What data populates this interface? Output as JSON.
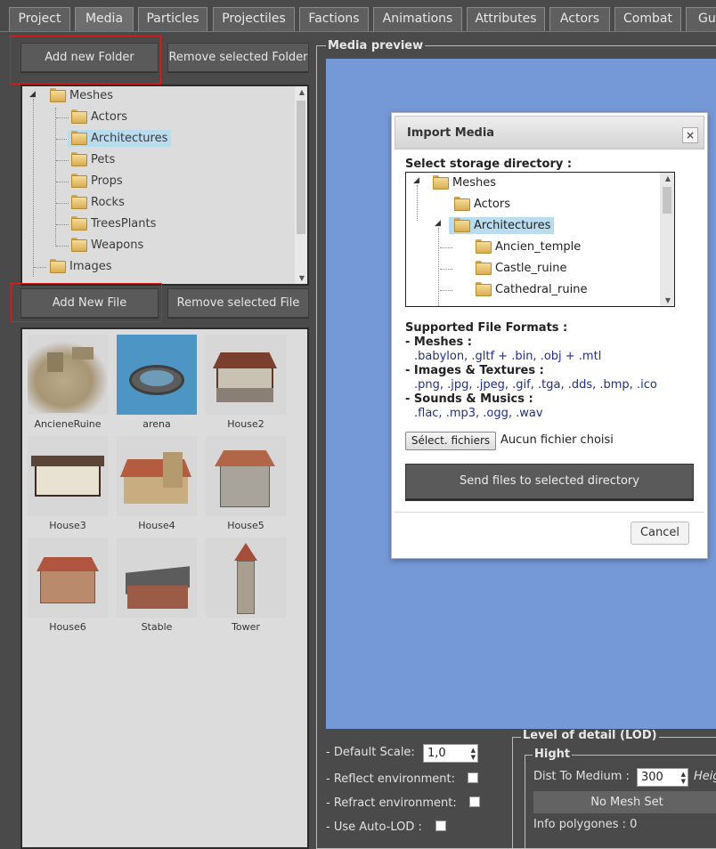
{
  "tabs": [
    "Project",
    "Media",
    "Particles",
    "Projectiles",
    "Factions",
    "Animations",
    "Attributes",
    "Actors",
    "Combat",
    "Gui"
  ],
  "active_tab": "Media",
  "folder_buttons": {
    "add": "Add new Folder",
    "remove": "Remove selected Folder"
  },
  "file_buttons": {
    "add": "Add New File",
    "remove": "Remove selected File"
  },
  "folder_tree": {
    "root": "Meshes",
    "children": [
      "Actors",
      "Architectures",
      "Pets",
      "Props",
      "Rocks",
      "TreesPlants",
      "Weapons"
    ],
    "selected": "Architectures",
    "next_root": "Images"
  },
  "files": [
    {
      "name": "AncieneRuine",
      "icon": "ruin-thumbnail"
    },
    {
      "name": "arena",
      "icon": "arena-thumbnail"
    },
    {
      "name": "House2",
      "icon": "house-thumbnail"
    },
    {
      "name": "House3",
      "icon": "house-thumbnail"
    },
    {
      "name": "House4",
      "icon": "house-thumbnail"
    },
    {
      "name": "House5",
      "icon": "house-thumbnail"
    },
    {
      "name": "House6",
      "icon": "house-thumbnail"
    },
    {
      "name": "Stable",
      "icon": "stable-thumbnail"
    },
    {
      "name": "Tower",
      "icon": "tower-thumbnail"
    }
  ],
  "preview": {
    "title": "Media preview"
  },
  "modal": {
    "title": "Import Media",
    "close": "×",
    "storage_label": "Select storage directory :",
    "tree": {
      "root": "Meshes",
      "children": [
        "Actors",
        "Architectures"
      ],
      "selected": "Architectures",
      "sub_children": [
        "Ancien_temple",
        "Castle_ruine",
        "Cathedral_ruine"
      ]
    },
    "formats_title": "Supported File Formats :",
    "formats": [
      {
        "label": "- Meshes :",
        "list": ".babylon, .gltf + .bin, .obj + .mtl"
      },
      {
        "label": "- Images & Textures :",
        "list": ".png, .jpg, .jpeg, .gif, .tga, .dds, .bmp, .ico"
      },
      {
        "label": "- Sounds & Musics :",
        "list": ".flac, .mp3, .ogg, .wav"
      }
    ],
    "file_button": "Sélect. fichiers",
    "no_file": "Aucun fichier choisi",
    "send": "Send files to selected directory",
    "cancel": "Cancel"
  },
  "options": {
    "default_scale_label": "- Default Scale:",
    "default_scale_value": "1,0",
    "reflect": "- Reflect environment:",
    "refract": "- Refract environment:",
    "auto_lod": "- Use Auto-LOD :"
  },
  "lod": {
    "title": "Level of detail (LOD)",
    "hight": "Hight",
    "dist_label": "Dist To Medium :",
    "dist_value": "300",
    "height_cut": "Heig",
    "no_mesh": "No Mesh Set",
    "info_polygones": "Info polygones : 0"
  }
}
